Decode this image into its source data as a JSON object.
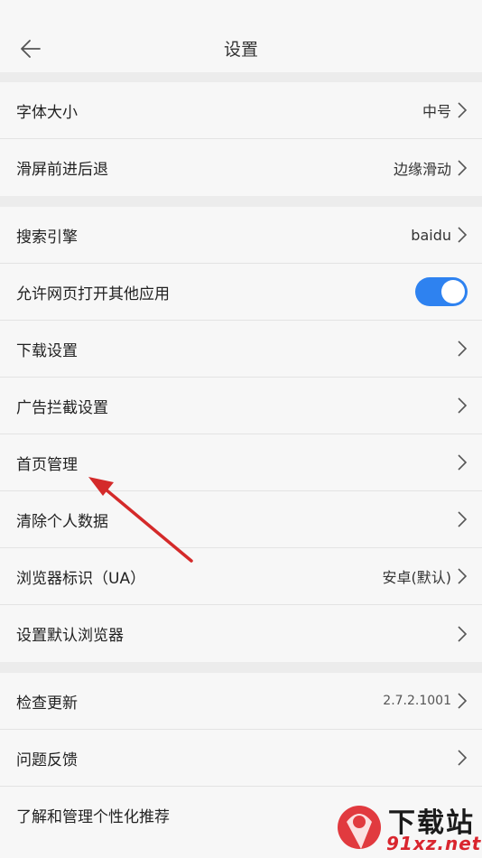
{
  "header": {
    "title": "设置"
  },
  "groups": [
    {
      "rows": [
        {
          "label": "字体大小",
          "value": "中号"
        },
        {
          "label": "滑屏前进后退",
          "value": "边缘滑动"
        }
      ]
    },
    {
      "rows": [
        {
          "label": "搜索引擎",
          "value": "baidu"
        },
        {
          "label": "允许网页打开其他应用",
          "toggle_on": true
        },
        {
          "label": "下载设置",
          "value": ""
        },
        {
          "label": "广告拦截设置",
          "value": ""
        },
        {
          "label": "首页管理",
          "value": ""
        },
        {
          "label": "清除个人数据",
          "value": ""
        },
        {
          "label": "浏览器标识（UA）",
          "value": "安卓(默认)"
        },
        {
          "label": "设置默认浏览器",
          "value": ""
        }
      ]
    },
    {
      "rows": [
        {
          "label": "检查更新",
          "value": "2.7.2.1001"
        },
        {
          "label": "问题反馈",
          "value": ""
        },
        {
          "label": "了解和管理个性化推荐",
          "value": ""
        }
      ]
    }
  ],
  "colors": {
    "accent": "#2e82f0",
    "annotation_arrow": "#d42a2a"
  },
  "watermark": {
    "text_top": "下载站",
    "text_bottom": "91xz.net"
  }
}
